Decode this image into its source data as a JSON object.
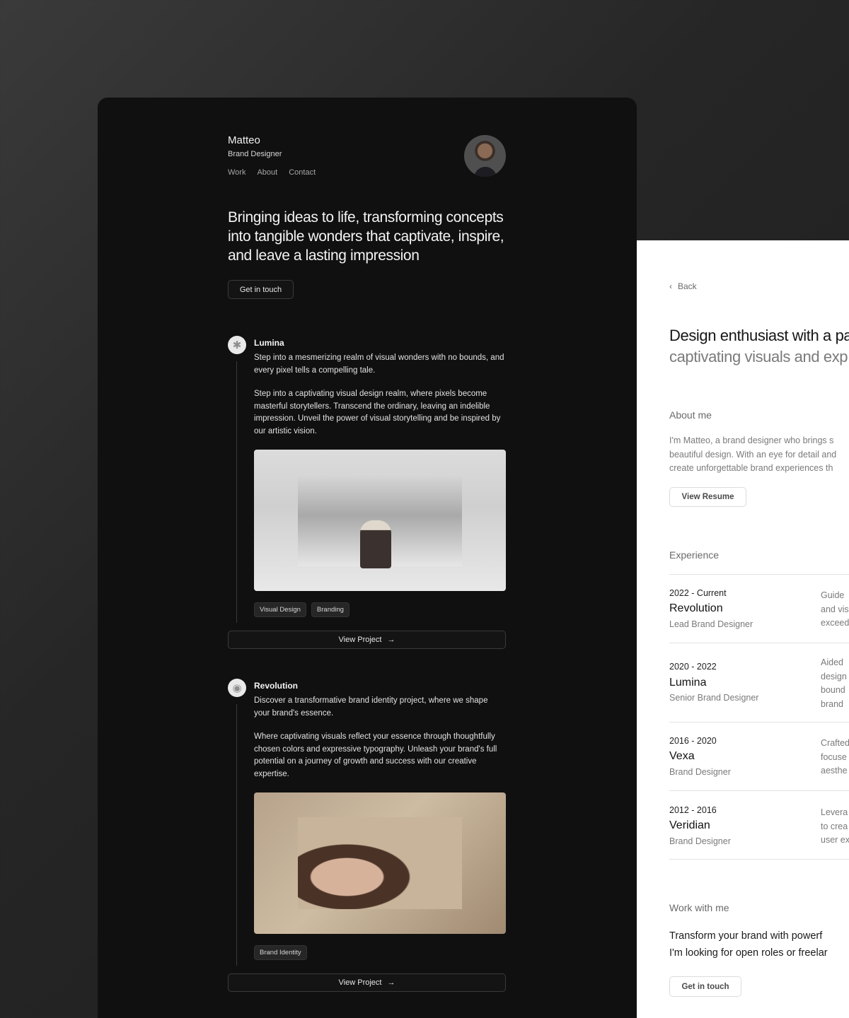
{
  "profile": {
    "name": "Matteo",
    "role": "Brand Designer"
  },
  "nav": [
    "Work",
    "About",
    "Contact"
  ],
  "hero": {
    "headline": "Bringing ideas to life, transforming concepts into tangible wonders that captivate, inspire, and leave a lasting impression",
    "cta": "Get in touch"
  },
  "projects": [
    {
      "title": "Lumina",
      "intro": "Step into a mesmerizing realm of visual wonders with no bounds, and every pixel tells a compelling tale.",
      "body": "Step into a captivating visual design realm, where pixels become masterful storytellers. Transcend the ordinary, leaving an indelible impression. Unveil the power of visual storytelling and be inspired by our artistic vision.",
      "tags": [
        "Visual Design",
        "Branding"
      ],
      "button": "View Project",
      "icon": "asterisk-icon"
    },
    {
      "title": "Revolution",
      "intro": "Discover a transformative brand identity project, where we shape your brand's essence.",
      "body": "Where captivating visuals reflect your essence through thoughtfully chosen colors and expressive typography. Unleash your brand's full potential on a journey of growth and success with our creative expertise.",
      "tags": [
        "Brand Identity"
      ],
      "button": "View Project",
      "icon": "ring-icon"
    }
  ],
  "detail": {
    "back": "Back",
    "headline1": "Design enthusiast with a pa",
    "headline2": "captivating visuals and exp",
    "about_title": "About me",
    "about_lines": [
      "I'm Matteo, a brand designer who brings s",
      "beautiful design. With an eye for detail and",
      "create unforgettable brand experiences th"
    ],
    "resume_button": "View Resume",
    "experience_title": "Experience",
    "experience": [
      {
        "years": "2022 - Current",
        "company": "Revolution",
        "role": "Lead Brand Designer",
        "desc": [
          "Guide",
          "and vis",
          "exceed"
        ]
      },
      {
        "years": "2020 - 2022",
        "company": "Lumina",
        "role": "Senior Brand Designer",
        "desc": [
          "Aided",
          "design",
          "bound",
          "brand"
        ]
      },
      {
        "years": "2016 - 2020",
        "company": "Vexa",
        "role": "Brand Designer",
        "desc": [
          "Crafted",
          "focuse",
          "aesthe"
        ]
      },
      {
        "years": "2012 - 2016",
        "company": "Veridian",
        "role": "Brand Designer",
        "desc": [
          "Levera",
          "to crea",
          "user ex"
        ]
      }
    ],
    "work_title": "Work with me",
    "work_lines": [
      "Transform your brand with powerf",
      "I'm looking for open roles or freelar"
    ],
    "work_button": "Get in touch"
  }
}
